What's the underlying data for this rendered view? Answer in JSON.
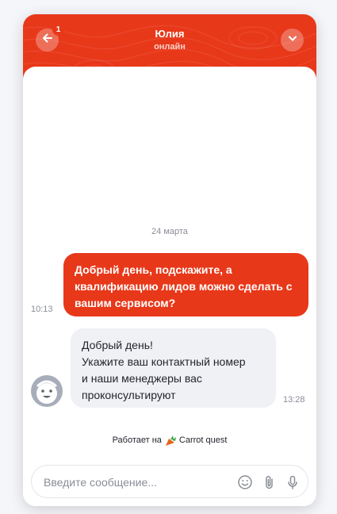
{
  "header": {
    "agent_name": "Юлия",
    "agent_status": "онлайн",
    "unread_count": "1",
    "accent_color": "#e8381a"
  },
  "conversation": {
    "date_separator": "24 марта",
    "messages": [
      {
        "direction": "outgoing",
        "text": "Добрый день, подскажите, а квалификацию лидов можно сделать с вашим сервисом?",
        "time": "10:13"
      },
      {
        "direction": "incoming",
        "lines": [
          "Добрый день!",
          "Укажите ваш контактный номер",
          "и наши менеджеры вас",
          "проконсультируют"
        ],
        "time": "13:28"
      }
    ]
  },
  "footer": {
    "powered_prefix": "Работает на",
    "powered_brand": "Carrot quest"
  },
  "composer": {
    "placeholder": "Введите сообщение...",
    "icons": [
      "emoji-icon",
      "attach-icon",
      "microphone-icon"
    ]
  }
}
